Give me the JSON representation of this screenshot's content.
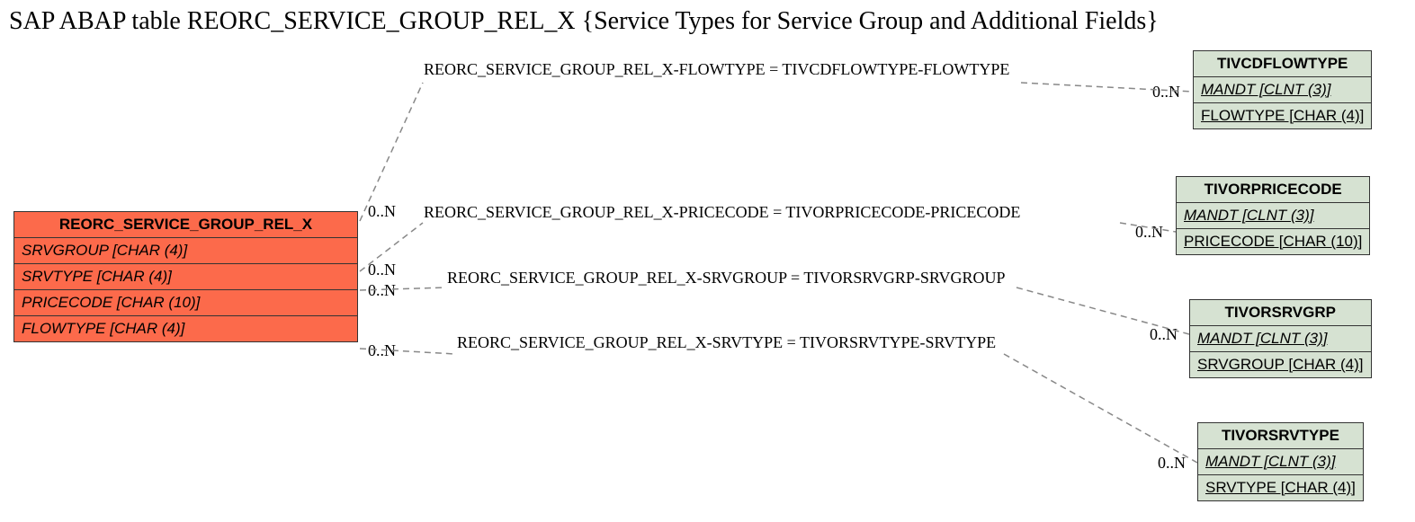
{
  "title": "SAP ABAP table REORC_SERVICE_GROUP_REL_X {Service Types for Service Group and Additional Fields}",
  "mainEntity": {
    "name": "REORC_SERVICE_GROUP_REL_X",
    "fields": [
      "SRVGROUP [CHAR (4)]",
      "SRVTYPE [CHAR (4)]",
      "PRICECODE [CHAR (10)]",
      "FLOWTYPE [CHAR (4)]"
    ]
  },
  "refEntities": [
    {
      "name": "TIVCDFLOWTYPE",
      "key": "MANDT [CLNT (3)]",
      "field": "FLOWTYPE [CHAR (4)]"
    },
    {
      "name": "TIVORPRICECODE",
      "key": "MANDT [CLNT (3)]",
      "field": "PRICECODE [CHAR (10)]"
    },
    {
      "name": "TIVORSRVGRP",
      "key": "MANDT [CLNT (3)]",
      "field": "SRVGROUP [CHAR (4)]"
    },
    {
      "name": "TIVORSRVTYPE",
      "key": "MANDT [CLNT (3)]",
      "field": "SRVTYPE [CHAR (4)]"
    }
  ],
  "relations": [
    {
      "label": "REORC_SERVICE_GROUP_REL_X-FLOWTYPE = TIVCDFLOWTYPE-FLOWTYPE",
      "leftCard": "0..N",
      "rightCard": "0..N"
    },
    {
      "label": "REORC_SERVICE_GROUP_REL_X-PRICECODE = TIVORPRICECODE-PRICECODE",
      "leftCard": "0..N",
      "rightCard": "0..N"
    },
    {
      "label": "REORC_SERVICE_GROUP_REL_X-SRVGROUP = TIVORSRVGRP-SRVGROUP",
      "leftCard": "0..N",
      "rightCard": "0..N"
    },
    {
      "label": "REORC_SERVICE_GROUP_REL_X-SRVTYPE = TIVORSRVTYPE-SRVTYPE",
      "leftCard": "0..N",
      "rightCard": "0..N"
    }
  ]
}
